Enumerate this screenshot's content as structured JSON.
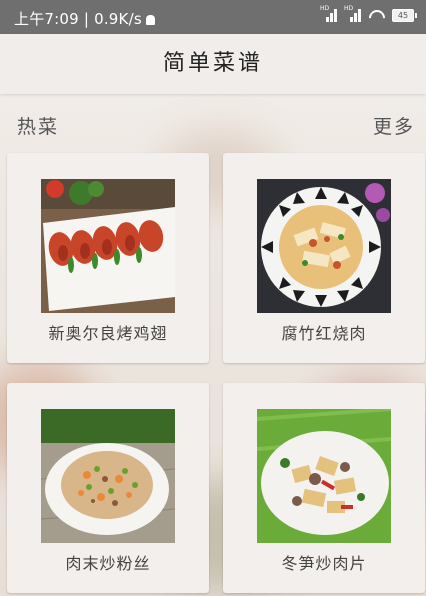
{
  "status_bar": {
    "left_text": "上午7:09 | 0.9K/s",
    "battery": "45"
  },
  "app_bar": {
    "title": "简单菜谱"
  },
  "section": {
    "title": "热菜",
    "more_label": "更多"
  },
  "recipes": [
    {
      "name": "新奥尔良烤鸡翅",
      "image_icon": "roasted-chicken-wings-photo"
    },
    {
      "name": "腐竹红烧肉",
      "image_icon": "braised-pork-tofu-skin-photo"
    },
    {
      "name": "肉末炒粉丝",
      "image_icon": "minced-meat-vermicelli-photo"
    },
    {
      "name": "冬笋炒肉片",
      "image_icon": "bamboo-shoot-pork-photo"
    }
  ],
  "colors": {
    "status_bar": "#6f6f6f",
    "app_bar": "#f0edea",
    "card": "#f2efec"
  }
}
